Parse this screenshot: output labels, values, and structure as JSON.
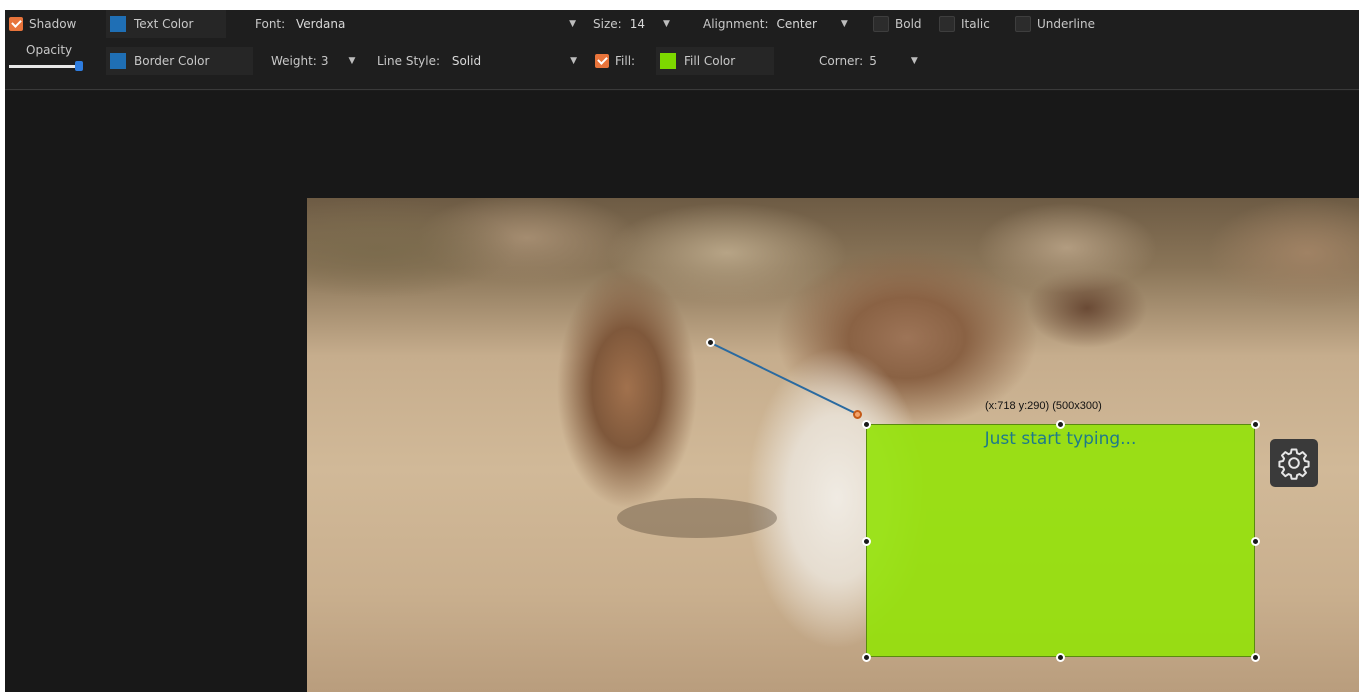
{
  "toolbar": {
    "shadow": {
      "label": "Shadow",
      "checked": true
    },
    "text_color": {
      "label": "Text Color",
      "swatch": "#1f6fb5"
    },
    "font": {
      "label": "Font:",
      "value": "Verdana"
    },
    "size": {
      "label": "Size:",
      "value": "14"
    },
    "alignment": {
      "label": "Alignment:",
      "value": "Center"
    },
    "bold": {
      "label": "Bold",
      "checked": false
    },
    "italic": {
      "label": "Italic",
      "checked": false
    },
    "underline": {
      "label": "Underline",
      "checked": false
    },
    "opacity": {
      "label": "Opacity",
      "level": 1.0
    },
    "border_color": {
      "label": "Border Color",
      "swatch": "#1f6fb5"
    },
    "weight": {
      "label": "Weight:",
      "value": "3"
    },
    "line_style": {
      "label": "Line Style:",
      "value": "Solid"
    },
    "fill": {
      "label": "Fill:",
      "checked": true
    },
    "fill_color": {
      "label": "Fill Color",
      "swatch": "#7dd800"
    },
    "corner": {
      "label": "Corner:",
      "value": "5"
    }
  },
  "annotation": {
    "placeholder": "Just start typing...",
    "coords_label": "(x:718 y:290) (500x300)",
    "fill": "#94e208",
    "connector_color": "#2a6aa0"
  },
  "icons": {
    "settings": "gear-icon",
    "dropdown": "chevron-down-icon"
  },
  "colors": {
    "accent_checkbox": "#e8743b",
    "toolbar_bg": "#1e1e1e"
  }
}
